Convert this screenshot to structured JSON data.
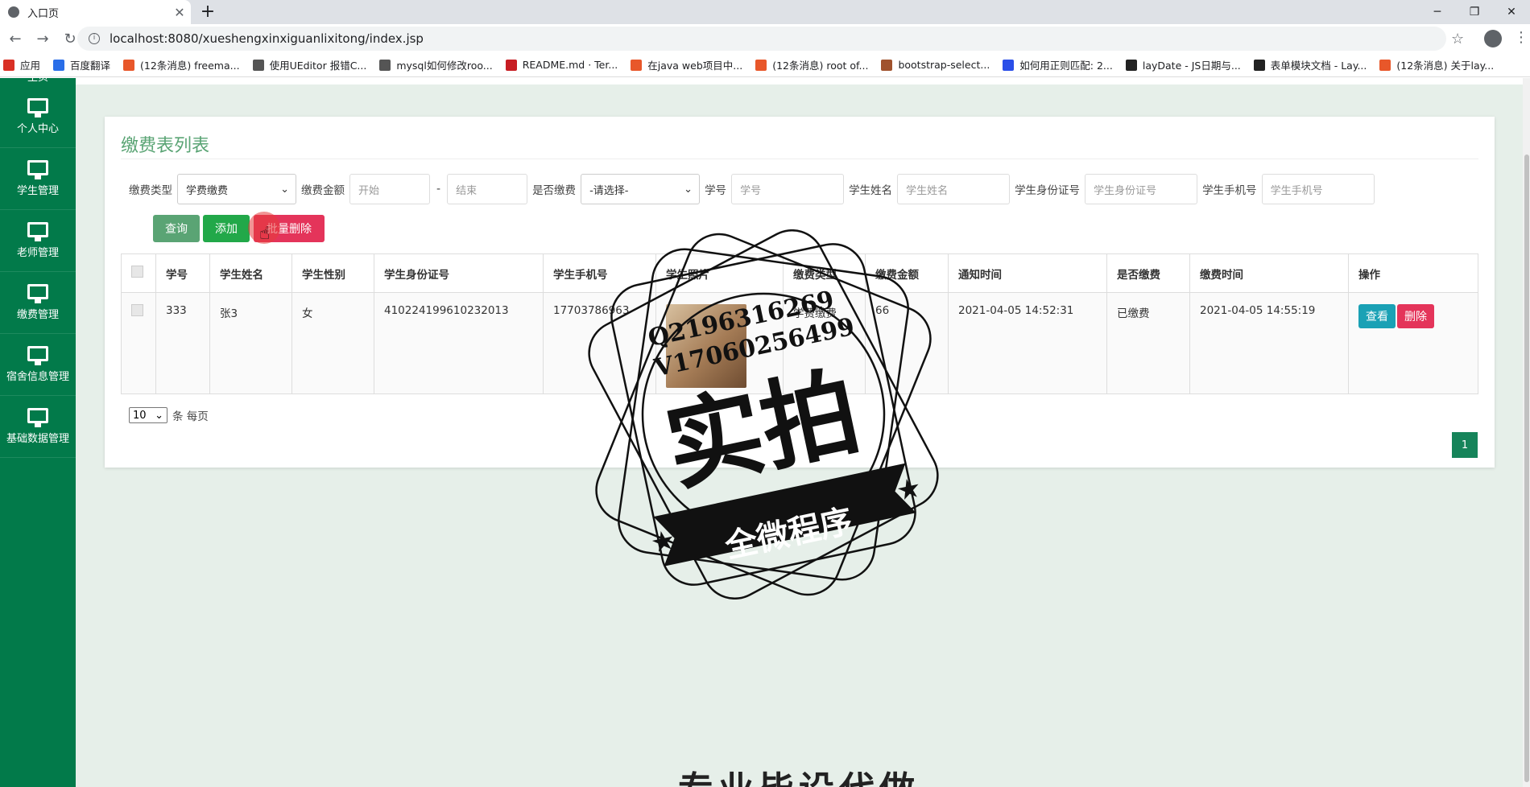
{
  "browser": {
    "tab_title": "入口页",
    "tab_close": "✕",
    "new_tab": "+",
    "url": "localhost:8080/xueshengxinxiguanlixitong/index.jsp",
    "bookmarks": [
      {
        "label": "应用",
        "color": "#d93025"
      },
      {
        "label": "百度翻译",
        "color": "#2a6ee8"
      },
      {
        "label": "(12条消息) freema...",
        "color": "#e8572a"
      },
      {
        "label": "使用UEditor 报错C...",
        "color": "#555555"
      },
      {
        "label": "mysql如何修改roo...",
        "color": "#555555"
      },
      {
        "label": "README.md · Ter...",
        "color": "#c71d23"
      },
      {
        "label": "在java web项目中...",
        "color": "#e8572a"
      },
      {
        "label": "(12条消息) root of...",
        "color": "#e8572a"
      },
      {
        "label": "bootstrap-select...",
        "color": "#a0522d"
      },
      {
        "label": "如何用正则匹配: 2...",
        "color": "#2a4ee8"
      },
      {
        "label": "layDate - JS日期与...",
        "color": "#222222"
      },
      {
        "label": "表单模块文档 - Lay...",
        "color": "#222222"
      },
      {
        "label": "(12条消息) 关于lay...",
        "color": "#e8572a"
      }
    ]
  },
  "sidebar": {
    "top_partial": "主页",
    "items": [
      {
        "label": "个人中心"
      },
      {
        "label": "学生管理"
      },
      {
        "label": "老师管理"
      },
      {
        "label": "缴费管理"
      },
      {
        "label": "宿舍信息管理"
      },
      {
        "label": "基础数据管理"
      }
    ]
  },
  "page": {
    "title": "缴费表列表",
    "filters": {
      "fee_type_label": "缴费类型",
      "fee_type_value": "学费缴费",
      "amount_label": "缴费金额",
      "amount_start_placeholder": "开始",
      "amount_dash": "-",
      "amount_end_placeholder": "结束",
      "paid_label": "是否缴费",
      "paid_value": "-请选择-",
      "student_no_label": "学号",
      "student_no_placeholder": "学号",
      "student_name_label": "学生姓名",
      "student_name_placeholder": "学生姓名",
      "id_card_label": "学生身份证号",
      "id_card_placeholder": "学生身份证号",
      "phone_label": "学生手机号",
      "phone_placeholder": "学生手机号"
    },
    "buttons": {
      "query": "查询",
      "add": "添加",
      "batch_delete": "批量删除"
    },
    "table": {
      "headers": [
        "学号",
        "学生姓名",
        "学生性别",
        "学生身份证号",
        "学生手机号",
        "学生照片",
        "缴费类型",
        "缴费金额",
        "通知时间",
        "是否缴费",
        "缴费时间",
        "操作"
      ],
      "rows": [
        {
          "student_no": "333",
          "name": "张3",
          "gender": "女",
          "id_card": "410224199610232013",
          "phone": "17703786963",
          "fee_type": "学费缴费",
          "amount": "66",
          "notice_time": "2021-04-05 14:52:31",
          "paid": "已缴费",
          "pay_time": "2021-04-05 14:55:19",
          "view_label": "查看",
          "delete_label": "删除"
        }
      ]
    },
    "pagination": {
      "page_size": "10",
      "per_page_suffix": "条 每页",
      "current_page": "1"
    },
    "bottom_text": "专业毕设代做"
  },
  "watermark": {
    "line1": "Q2196316269",
    "line2": "V17060256499",
    "main": "实拍",
    "ribbon": "全微程序"
  }
}
